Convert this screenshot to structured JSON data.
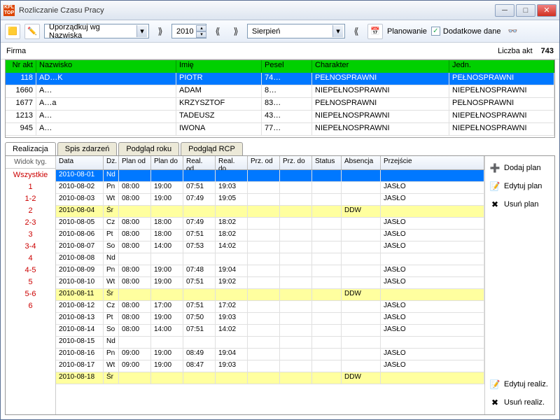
{
  "title": "Rozliczanie Czasu Pracy",
  "toolbar": {
    "sort_combo": "Uporządkuj wg Nazwiska",
    "year": "2010",
    "month": "Sierpień",
    "plan_label": "Planowanie",
    "extra_label": "Dodatkowe dane",
    "extra_checked": true
  },
  "firm": {
    "label": "Firma",
    "value": "",
    "count_label": "Liczba akt",
    "count": "743"
  },
  "emp_headers": {
    "nr": "Nr akt",
    "naz": "Nazwisko",
    "im": "Imię",
    "pe": "Pesel",
    "ch": "Charakter",
    "je": "Jedn."
  },
  "employees": [
    {
      "nr": "118",
      "naz": "AD…K",
      "im": "PIOTR",
      "pe": "74…",
      "ch": "PEŁNOSPRAWNI",
      "je": "PEŁNOSPRAWNI",
      "sel": true
    },
    {
      "nr": "1660",
      "naz": "A…",
      "im": "ADAM",
      "pe": "8…",
      "ch": "NIEPEŁNOSPRAWNI",
      "je": "NIEPEŁNOSPRAWNI"
    },
    {
      "nr": "1677",
      "naz": "A…a",
      "im": "KRZYSZTOF",
      "pe": "83…",
      "ch": "PEŁNOSPRAWNI",
      "je": "PEŁNOSPRAWNI"
    },
    {
      "nr": "1213",
      "naz": "A…",
      "im": "TADEUSZ",
      "pe": "43…",
      "ch": "NIEPEŁNOSPRAWNI",
      "je": "NIEPEŁNOSPRAWNI"
    },
    {
      "nr": "945",
      "naz": "A…",
      "im": "IWONA",
      "pe": "77…",
      "ch": "NIEPEŁNOSPRAWNI",
      "je": "NIEPEŁNOSPRAWNI"
    }
  ],
  "tabs": [
    "Realizacja",
    "Spis zdarzeń",
    "Podgląd roku",
    "Podgląd RCP"
  ],
  "active_tab": 0,
  "week_header": "Widok tyg.",
  "weeks": [
    "Wszystkie",
    "1",
    "1-2",
    "2",
    "2-3",
    "3",
    "3-4",
    "4",
    "4-5",
    "5",
    "5-6",
    "6"
  ],
  "sch_headers": {
    "dt": "Data",
    "dz": "Dz.",
    "po": "Plan od",
    "pd": "Plan do",
    "ro": "Real. od",
    "rd": "Real. do",
    "przod": "Prz. od",
    "przdo": "Prz. do",
    "st": "Status",
    "ab": "Absencja",
    "pr": "Przejście"
  },
  "sched": [
    {
      "dt": "2010-08-01",
      "dz": "Nd",
      "cls": "sel"
    },
    {
      "dt": "2010-08-02",
      "dz": "Pn",
      "po": "08:00",
      "pd": "19:00",
      "ro": "07:51",
      "rd": "19:03",
      "pr": "JASŁO"
    },
    {
      "dt": "2010-08-03",
      "dz": "Wt",
      "po": "08:00",
      "pd": "19:00",
      "ro": "07:49",
      "rd": "19:05",
      "pr": "JASŁO"
    },
    {
      "dt": "2010-08-04",
      "dz": "Śr",
      "ab": "DDW",
      "cls": "yel"
    },
    {
      "dt": "2010-08-05",
      "dz": "Cz",
      "po": "08:00",
      "pd": "18:00",
      "ro": "07:49",
      "rd": "18:02",
      "pr": "JASŁO"
    },
    {
      "dt": "2010-08-06",
      "dz": "Pt",
      "po": "08:00",
      "pd": "18:00",
      "ro": "07:51",
      "rd": "18:02",
      "pr": "JASŁO"
    },
    {
      "dt": "2010-08-07",
      "dz": "So",
      "po": "08:00",
      "pd": "14:00",
      "ro": "07:53",
      "rd": "14:02",
      "pr": "JASŁO"
    },
    {
      "dt": "2010-08-08",
      "dz": "Nd"
    },
    {
      "dt": "2010-08-09",
      "dz": "Pn",
      "po": "08:00",
      "pd": "19:00",
      "ro": "07:48",
      "rd": "19:04",
      "pr": "JASŁO"
    },
    {
      "dt": "2010-08-10",
      "dz": "Wt",
      "po": "08:00",
      "pd": "19:00",
      "ro": "07:51",
      "rd": "19:02",
      "pr": "JASŁO"
    },
    {
      "dt": "2010-08-11",
      "dz": "Śr",
      "ab": "DDW",
      "cls": "yel"
    },
    {
      "dt": "2010-08-12",
      "dz": "Cz",
      "po": "08:00",
      "pd": "17:00",
      "ro": "07:51",
      "rd": "17:02",
      "pr": "JASŁO"
    },
    {
      "dt": "2010-08-13",
      "dz": "Pt",
      "po": "08:00",
      "pd": "19:00",
      "ro": "07:50",
      "rd": "19:03",
      "pr": "JASŁO"
    },
    {
      "dt": "2010-08-14",
      "dz": "So",
      "po": "08:00",
      "pd": "14:00",
      "ro": "07:51",
      "rd": "14:02",
      "pr": "JASŁO"
    },
    {
      "dt": "2010-08-15",
      "dz": "Nd"
    },
    {
      "dt": "2010-08-16",
      "dz": "Pn",
      "po": "09:00",
      "pd": "19:00",
      "ro": "08:49",
      "rd": "19:04",
      "pr": "JASŁO"
    },
    {
      "dt": "2010-08-17",
      "dz": "Wt",
      "po": "09:00",
      "pd": "19:00",
      "ro": "08:47",
      "rd": "19:03",
      "pr": "JASŁO"
    },
    {
      "dt": "2010-08-18",
      "dz": "Śr",
      "ab": "DDW",
      "cls": "yel"
    }
  ],
  "actions": {
    "add": "Dodaj plan",
    "edit": "Edytuj plan",
    "del": "Usuń plan",
    "editr": "Edytuj realiz.",
    "delr": "Usuń realiz."
  }
}
